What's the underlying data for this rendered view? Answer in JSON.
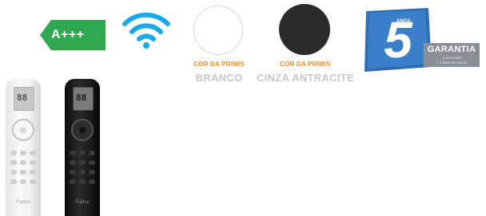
{
  "energy_class": {
    "label": "A+++",
    "color": "#2fa84f"
  },
  "wifi": {
    "icon": "wifi-icon",
    "color": "#1aa8e6"
  },
  "colors": [
    {
      "caption": "COR DA PRIMIS",
      "name": "BRANCO",
      "swatch": "#ffffff"
    },
    {
      "caption": "COR DA PRIMIS",
      "name": "CINZA ANTRACITE",
      "swatch": "#2b2b2b"
    }
  ],
  "warranty": {
    "years": "5",
    "years_label": "ANOS",
    "title": "GARANTIA",
    "line1": "2 anos total",
    "line2": "+ 3 anos em peças",
    "color": "#2f6db4"
  },
  "remotes": [
    {
      "display": "88",
      "brand": "Fujitsu"
    },
    {
      "display": "88",
      "brand": "Fujitsu"
    }
  ]
}
